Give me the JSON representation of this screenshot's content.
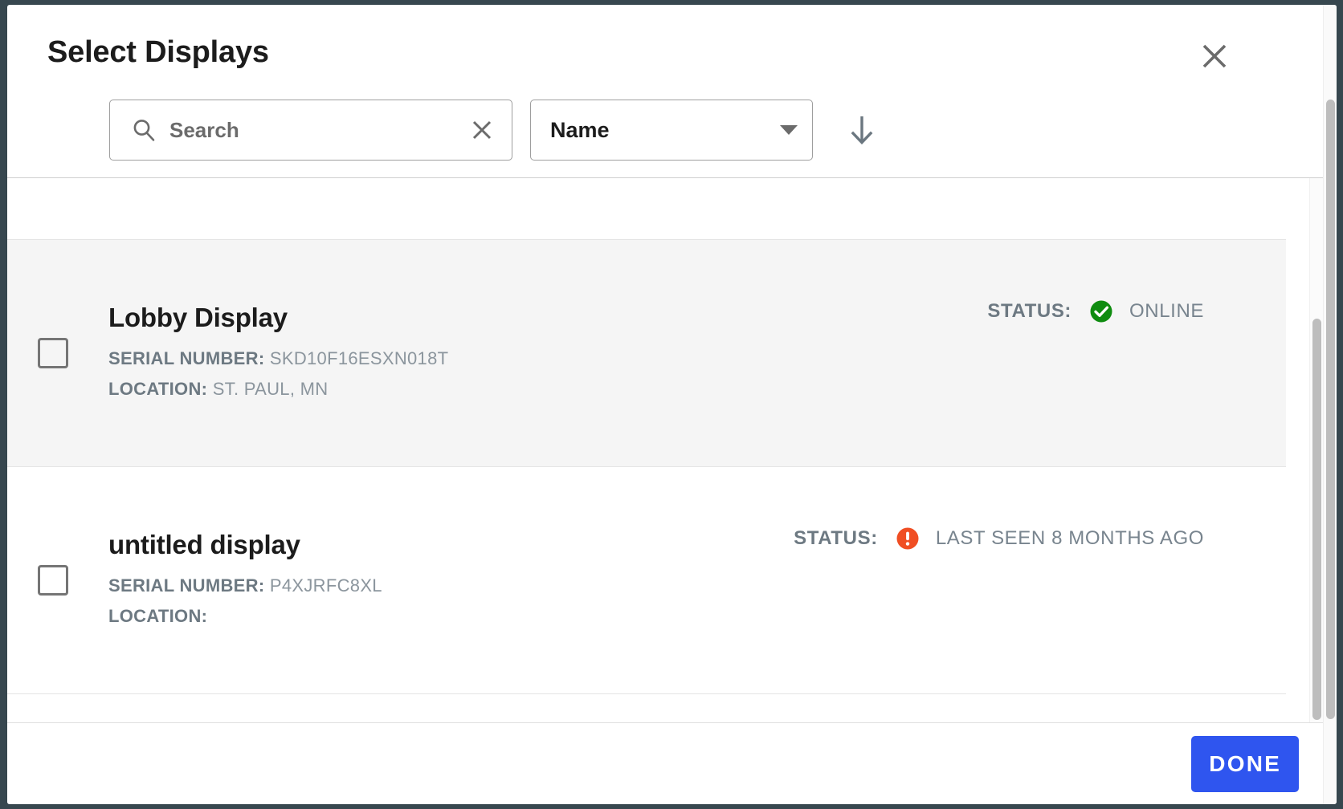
{
  "dialog": {
    "title": "Select Displays",
    "close_icon": "close-icon"
  },
  "toolbar": {
    "search": {
      "icon": "search-icon",
      "placeholder": "Search",
      "value": "",
      "clear_icon": "close-icon"
    },
    "sort": {
      "selected": "Name",
      "caret_icon": "chevron-down-icon",
      "direction_icon": "arrow-down-icon",
      "direction": "descending"
    }
  },
  "list": {
    "rows": [
      {
        "name": "Lobby Display",
        "serial_label": "SERIAL NUMBER:",
        "serial_value": "SKD10F16ESXN018T",
        "location_label": "LOCATION:",
        "location_value": "ST. PAUL, MN",
        "status_label": "STATUS:",
        "status_icon": "check-circle-icon",
        "status_color": "#0f8c10",
        "status_text": "ONLINE",
        "checked": false
      },
      {
        "name": "untitled display",
        "serial_label": "SERIAL NUMBER:",
        "serial_value": "P4XJRFC8XL",
        "location_label": "LOCATION:",
        "location_value": "",
        "status_label": "STATUS:",
        "status_icon": "alert-circle-icon",
        "status_color": "#f04e23",
        "status_text": "LAST SEEN 8 MONTHS AGO",
        "checked": false
      }
    ]
  },
  "footer": {
    "done_label": "DONE"
  },
  "colors": {
    "accent": "#2f55ef",
    "online": "#0f8c10",
    "warning": "#f04e23",
    "page_background": "#37474f",
    "row_shaded": "#f5f5f5"
  }
}
